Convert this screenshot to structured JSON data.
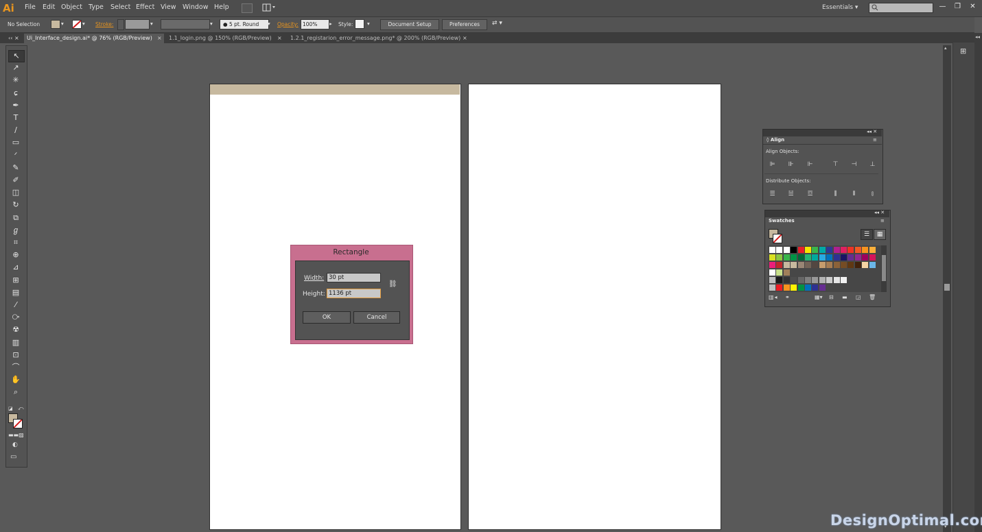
{
  "app": {
    "logo": "Ai",
    "accent_color": "#e8951f"
  },
  "menu": [
    "File",
    "Edit",
    "Object",
    "Type",
    "Select",
    "Effect",
    "View",
    "Window",
    "Help"
  ],
  "workspace": {
    "label": "Essentials",
    "arrow": "▾"
  },
  "window_controls": [
    "—",
    "❐",
    "✕"
  ],
  "control": {
    "selection": "No Selection",
    "stroke_label": "Stroke:",
    "brush_label": "5 pt. Round",
    "opacity_label": "Opacity:",
    "opacity_value": "100%",
    "style_label": "Style:",
    "document_setup": "Document Setup",
    "preferences": "Preferences"
  },
  "tabs": [
    {
      "label": "Ui_Interface_design.ai* @ 76% (RGB/Preview)",
      "active": true
    },
    {
      "label": "1.1_login.png @ 150% (RGB/Preview)",
      "active": false
    },
    {
      "label": "1.2.1_registarion_error_message.png* @ 200% (RGB/Preview)",
      "active": false
    }
  ],
  "tab_close": "×",
  "tools": [
    "selection-icon",
    "direct-selection-icon",
    "magic-wand-icon",
    "lasso-icon",
    "pen-icon",
    "type-icon",
    "line-icon",
    "rectangle-icon",
    "paintbrush-icon",
    "pencil-icon",
    "blob-brush-icon",
    "eraser-icon",
    "rotate-icon",
    "scale-icon",
    "warp-icon",
    "free-transform-icon",
    "shape-builder-icon",
    "perspective-icon",
    "mesh-icon",
    "gradient-icon",
    "eyedropper-icon",
    "blend-icon",
    "symbol-sprayer-icon",
    "graph-icon",
    "artboard-icon",
    "slice-icon",
    "hand-icon",
    "zoom-icon"
  ],
  "tool_glyphs": [
    "↖",
    "↗",
    "✳",
    "ɕ",
    "✒",
    "T",
    "∕",
    "▭",
    "ᐟ",
    "✎",
    "✐",
    "◫",
    "↻",
    "⧉",
    "ℊ",
    "⌗",
    "⊕",
    "⊿",
    "⊞",
    "▤",
    "⁄",
    "⧂",
    "☢",
    "▥",
    "⊡",
    "⌒",
    "✋",
    "⌕"
  ],
  "colors": {
    "fill": "#c7b99f",
    "stroke": "none",
    "artboard_bar": "#c7b99f",
    "dialog_frame": "#c86f8f"
  },
  "dialog": {
    "title": "Rectangle",
    "width_label": "Width:",
    "width_value": "30 pt",
    "height_label": "Height:",
    "height_value": "1136 pt",
    "ok": "OK",
    "cancel": "Cancel"
  },
  "align_panel": {
    "tab": "Align",
    "align_objects": "Align Objects:",
    "distribute_objects": "Distribute Objects:"
  },
  "swatches_panel": {
    "tab": "Swatches"
  },
  "watermark": "DesignOptimal.com"
}
